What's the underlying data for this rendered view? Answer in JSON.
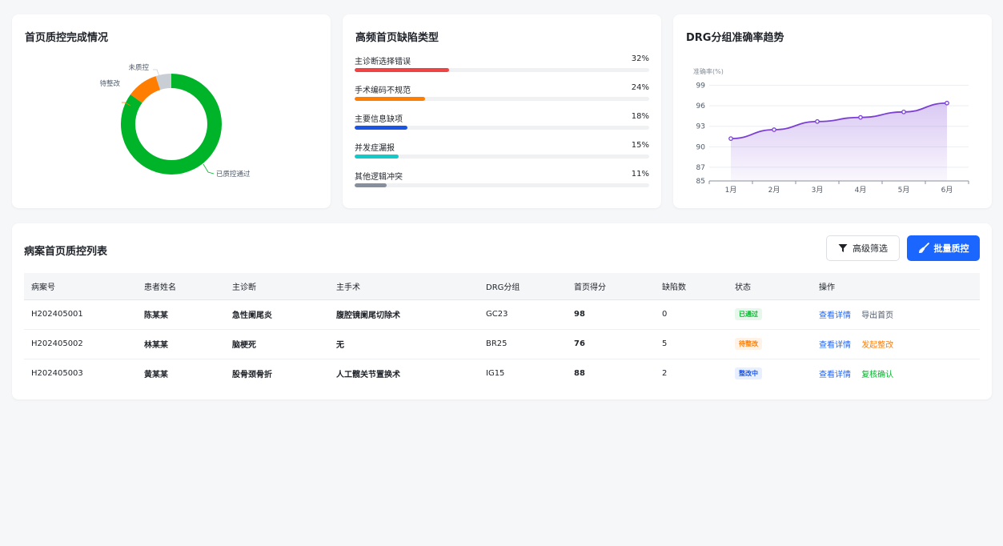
{
  "donut_card": {
    "title": "首页质控完成情况",
    "chart_data": {
      "type": "pie",
      "categories": [
        "已质控通过",
        "待整改",
        "未质控"
      ],
      "values": [
        85,
        10,
        5
      ],
      "colors": [
        "#00b42a",
        "#ff7d00",
        "#c9cdd4"
      ]
    }
  },
  "defect_card": {
    "title": "高频首页缺陷类型",
    "chart_data": {
      "type": "bar",
      "categories": [
        "主诊断选择错误",
        "手术编码不规范",
        "主要信息缺项",
        "并发症漏报",
        "其他逻辑冲突"
      ],
      "values": [
        32,
        24,
        18,
        15,
        11
      ],
      "labels": [
        "32%",
        "24%",
        "18%",
        "15%",
        "11%"
      ],
      "colors": [
        "#f04444",
        "#ff7d00",
        "#1a55e6",
        "#14c9c9",
        "#86909c"
      ]
    }
  },
  "trend_card": {
    "title": "DRG分组准确率趋势",
    "chart_data": {
      "type": "line",
      "categories": [
        "1月",
        "2月",
        "3月",
        "4月",
        "5月",
        "6月"
      ],
      "values": [
        91.2,
        92.5,
        93.7,
        94.3,
        95.1,
        96.4
      ],
      "ylabel": "准确率(%)",
      "ylim": [
        85,
        100
      ],
      "yticks": [
        85,
        87,
        90,
        93,
        96,
        99
      ],
      "color": "#7b3fd6",
      "grid": true
    }
  },
  "table_card": {
    "title": "病案首页质控列表",
    "filter_label": "高级筛选",
    "batch_label": "批量质控",
    "headers": [
      "病案号",
      "患者姓名",
      "主诊断",
      "主手术",
      "DRG分组",
      "首页得分",
      "缺陷数",
      "状态",
      "操作"
    ],
    "rows": [
      {
        "id": "H202405001",
        "name": "陈某某",
        "diag": "急性阑尾炎",
        "op": "腹腔镜阑尾切除术",
        "drg": "GC23",
        "score": "98",
        "defects": "0",
        "status": "已通过",
        "status_color": "#00b42a",
        "status_bg": "#e8f7ec",
        "actions": [
          "查看详情",
          "导出首页"
        ],
        "action2_color": "#4e5969"
      },
      {
        "id": "H202405002",
        "name": "林某某",
        "diag": "脑梗死",
        "op": "无",
        "drg": "BR25",
        "score": "76",
        "defects": "5",
        "status": "待整改",
        "status_color": "#ff7d00",
        "status_bg": "#fff3e8",
        "actions": [
          "查看详情",
          "发起整改"
        ],
        "action2_color": "#ff7d00"
      },
      {
        "id": "H202405003",
        "name": "黄某某",
        "diag": "股骨颈骨折",
        "op": "人工髋关节置换术",
        "drg": "IG15",
        "score": "88",
        "defects": "2",
        "status": "整改中",
        "status_color": "#1a55e6",
        "status_bg": "#e8f0ff",
        "actions": [
          "查看详情",
          "复核确认"
        ],
        "action2_color": "#00b42a"
      }
    ]
  }
}
